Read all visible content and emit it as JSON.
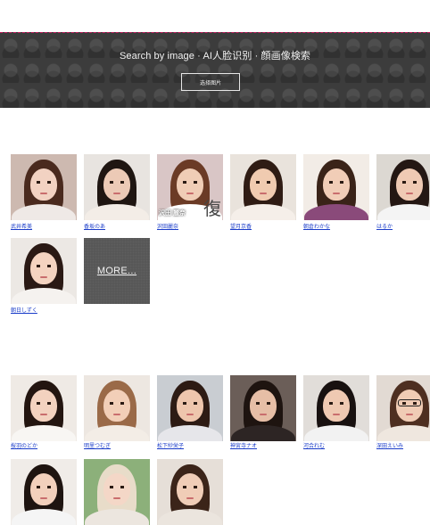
{
  "banner": {
    "title": "Search by image · AI人脸识别 · 顔画像検索",
    "button_label": "选择图片"
  },
  "section1": {
    "row1": [
      {
        "name": "武井希美",
        "palette": {
          "bg": "#cdb9b0",
          "hair": "#4a2a1e",
          "skin": "#f2d2c2",
          "clothes": "#efe9e6"
        }
      },
      {
        "name": "香坂のあ",
        "palette": {
          "bg": "#e8e4e0",
          "hair": "#1f1612",
          "skin": "#eccab6",
          "clothes": "#f3ede7"
        }
      },
      {
        "name": "沢田麗奈",
        "palette": {
          "bg": "#d9c6c6",
          "hair": "#6b3b26",
          "skin": "#f0cdb6",
          "clothes": "#ffffff"
        },
        "cover": true,
        "cover_text": "沢田 麗奈",
        "cover_big": "復"
      },
      {
        "name": "望月京香",
        "palette": {
          "bg": "#e9e3dc",
          "hair": "#2f1c14",
          "skin": "#f0cbb0",
          "clothes": "#f5efe9"
        }
      },
      {
        "name": "朝倉わかな",
        "palette": {
          "bg": "#f2ece6",
          "hair": "#3a2318",
          "skin": "#f1cdb7",
          "clothes": "#8a4a7a"
        }
      },
      {
        "name": "はるか",
        "palette": {
          "bg": "#dcd8d2",
          "hair": "#241713",
          "skin": "#efcab4",
          "clothes": "#f4f4f4"
        }
      }
    ],
    "row2": [
      {
        "name": "朝日しずく",
        "palette": {
          "bg": "#ece8e4",
          "hair": "#2a1914",
          "skin": "#f4d3c0",
          "clothes": "#f5f2ef"
        }
      }
    ],
    "more_label": "MORE..."
  },
  "section2": {
    "row1": [
      {
        "name": "桜羽のどか",
        "palette": {
          "bg": "#efeae5",
          "hair": "#231510",
          "skin": "#f3d2bf",
          "clothes": "#f8f6f3"
        }
      },
      {
        "name": "明里つむぎ",
        "palette": {
          "bg": "#ede7e1",
          "hair": "#9a6a48",
          "skin": "#f2cfb8",
          "clothes": "#f3ede6"
        }
      },
      {
        "name": "松下紗栄子",
        "palette": {
          "bg": "#c9cdd2",
          "hair": "#2d1b14",
          "skin": "#eec6ad",
          "clothes": "#e6e6ea"
        }
      },
      {
        "name": "神宮寺ナオ",
        "palette": {
          "bg": "#6b5e58",
          "hair": "#1e1410",
          "skin": "#e6bea6",
          "clothes": "#2d2524"
        }
      },
      {
        "name": "河合れむ",
        "palette": {
          "bg": "#e1ddd9",
          "hair": "#181110",
          "skin": "#efc9b2",
          "clothes": "#f2f2f2"
        }
      },
      {
        "name": "深田えいみ",
        "palette": {
          "bg": "#e2dad3",
          "hair": "#4e2f21",
          "skin": "#f0ccb5",
          "clothes": "#efe7df"
        },
        "glasses": true
      }
    ],
    "row2": [
      {
        "palette": {
          "bg": "#f0ece8",
          "hair": "#1e1410",
          "skin": "#f2d0bc",
          "clothes": "#f5f5f5"
        }
      },
      {
        "palette": {
          "bg": "#8cb07a",
          "hair": "#e8dcc9",
          "skin": "#f4d7c7",
          "clothes": "#ece6df"
        }
      },
      {
        "palette": {
          "bg": "#e6dfd8",
          "hair": "#3b2419",
          "skin": "#f0cdb7",
          "clothes": "#ebe5de"
        }
      }
    ]
  }
}
